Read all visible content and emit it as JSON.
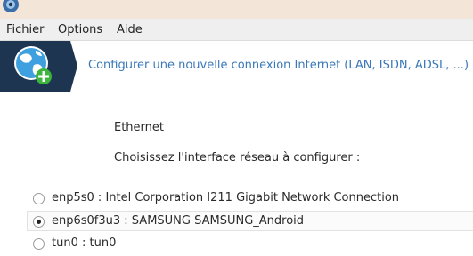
{
  "titlebar": {
    "app_icon": "gear-icon"
  },
  "menu": {
    "items": [
      "Fichier",
      "Options",
      "Aide"
    ]
  },
  "banner": {
    "icon": "network-globe-add-icon",
    "title": "Configurer une nouvelle connexion Internet (LAN, ISDN, ADSL, ...)"
  },
  "content": {
    "connection_type": "Ethernet",
    "prompt": "Choisissez l'interface réseau à configurer :",
    "interfaces": [
      {
        "label": "enp5s0 : Intel Corporation I211 Gigabit Network Connection",
        "selected": false
      },
      {
        "label": "enp6s0f3u3 : SAMSUNG SAMSUNG_Android",
        "selected": true
      },
      {
        "label": "tun0 : tun0",
        "selected": false
      }
    ]
  },
  "colors": {
    "banner_bg": "#1d3550",
    "accent": "#3a78b8",
    "globe_blue": "#3fa0e0",
    "plus_green": "#3cb53c"
  }
}
